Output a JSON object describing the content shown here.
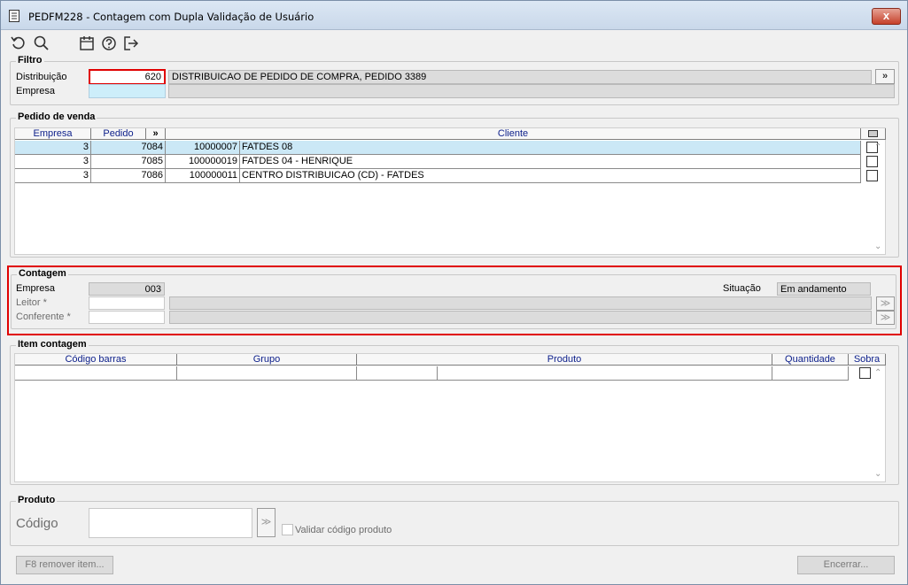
{
  "window": {
    "title": "PEDFM228 - Contagem com Dupla Validação de Usuário",
    "close_label": "x"
  },
  "toolbar": {
    "icons": [
      "refresh-icon",
      "search-icon",
      "calendar-icon",
      "help-icon",
      "exit-icon"
    ]
  },
  "filtro": {
    "title": "Filtro",
    "distribuicao_label": "Distribuição",
    "distribuicao_value": "620",
    "distribuicao_desc": "DISTRIBUICAO DE PEDIDO DE COMPRA, PEDIDO 3389",
    "empresa_label": "Empresa",
    "empresa_value": "",
    "empresa_desc": "",
    "more_button": "»"
  },
  "pedido_venda": {
    "title": "Pedido de venda",
    "columns": [
      "Empresa",
      "Pedido",
      "»",
      "Cliente"
    ],
    "rows": [
      {
        "empresa": "3",
        "pedido": "7084",
        "codigo": "10000007",
        "cliente": "FATDES 08",
        "selected": true
      },
      {
        "empresa": "3",
        "pedido": "7085",
        "codigo": "100000019",
        "cliente": "FATDES 04 - HENRIQUE",
        "selected": false
      },
      {
        "empresa": "3",
        "pedido": "7086",
        "codigo": "100000011",
        "cliente": "CENTRO DISTRIBUICAO (CD) - FATDES",
        "selected": false
      }
    ]
  },
  "contagem": {
    "title": "Contagem",
    "empresa_label": "Empresa",
    "empresa_value": "003",
    "situacao_label": "Situação",
    "situacao_value": "Em andamento",
    "leitor_label": "Leitor *",
    "conferente_label": "Conferente *"
  },
  "item_contagem": {
    "title": "Item contagem",
    "columns": [
      "Código barras",
      "Grupo",
      "Produto",
      "Quantidade",
      "Sobra"
    ]
  },
  "produto": {
    "title": "Produto",
    "codigo_label": "Código",
    "codigo_value": "",
    "validar_label": "Validar código produto"
  },
  "footer": {
    "remover_label": "F8 remover item...",
    "encerrar_label": "Encerrar..."
  },
  "colors": {
    "highlight_border": "#e00000",
    "selected_row": "#cbe8f6",
    "header_text": "#0b1e8a"
  }
}
